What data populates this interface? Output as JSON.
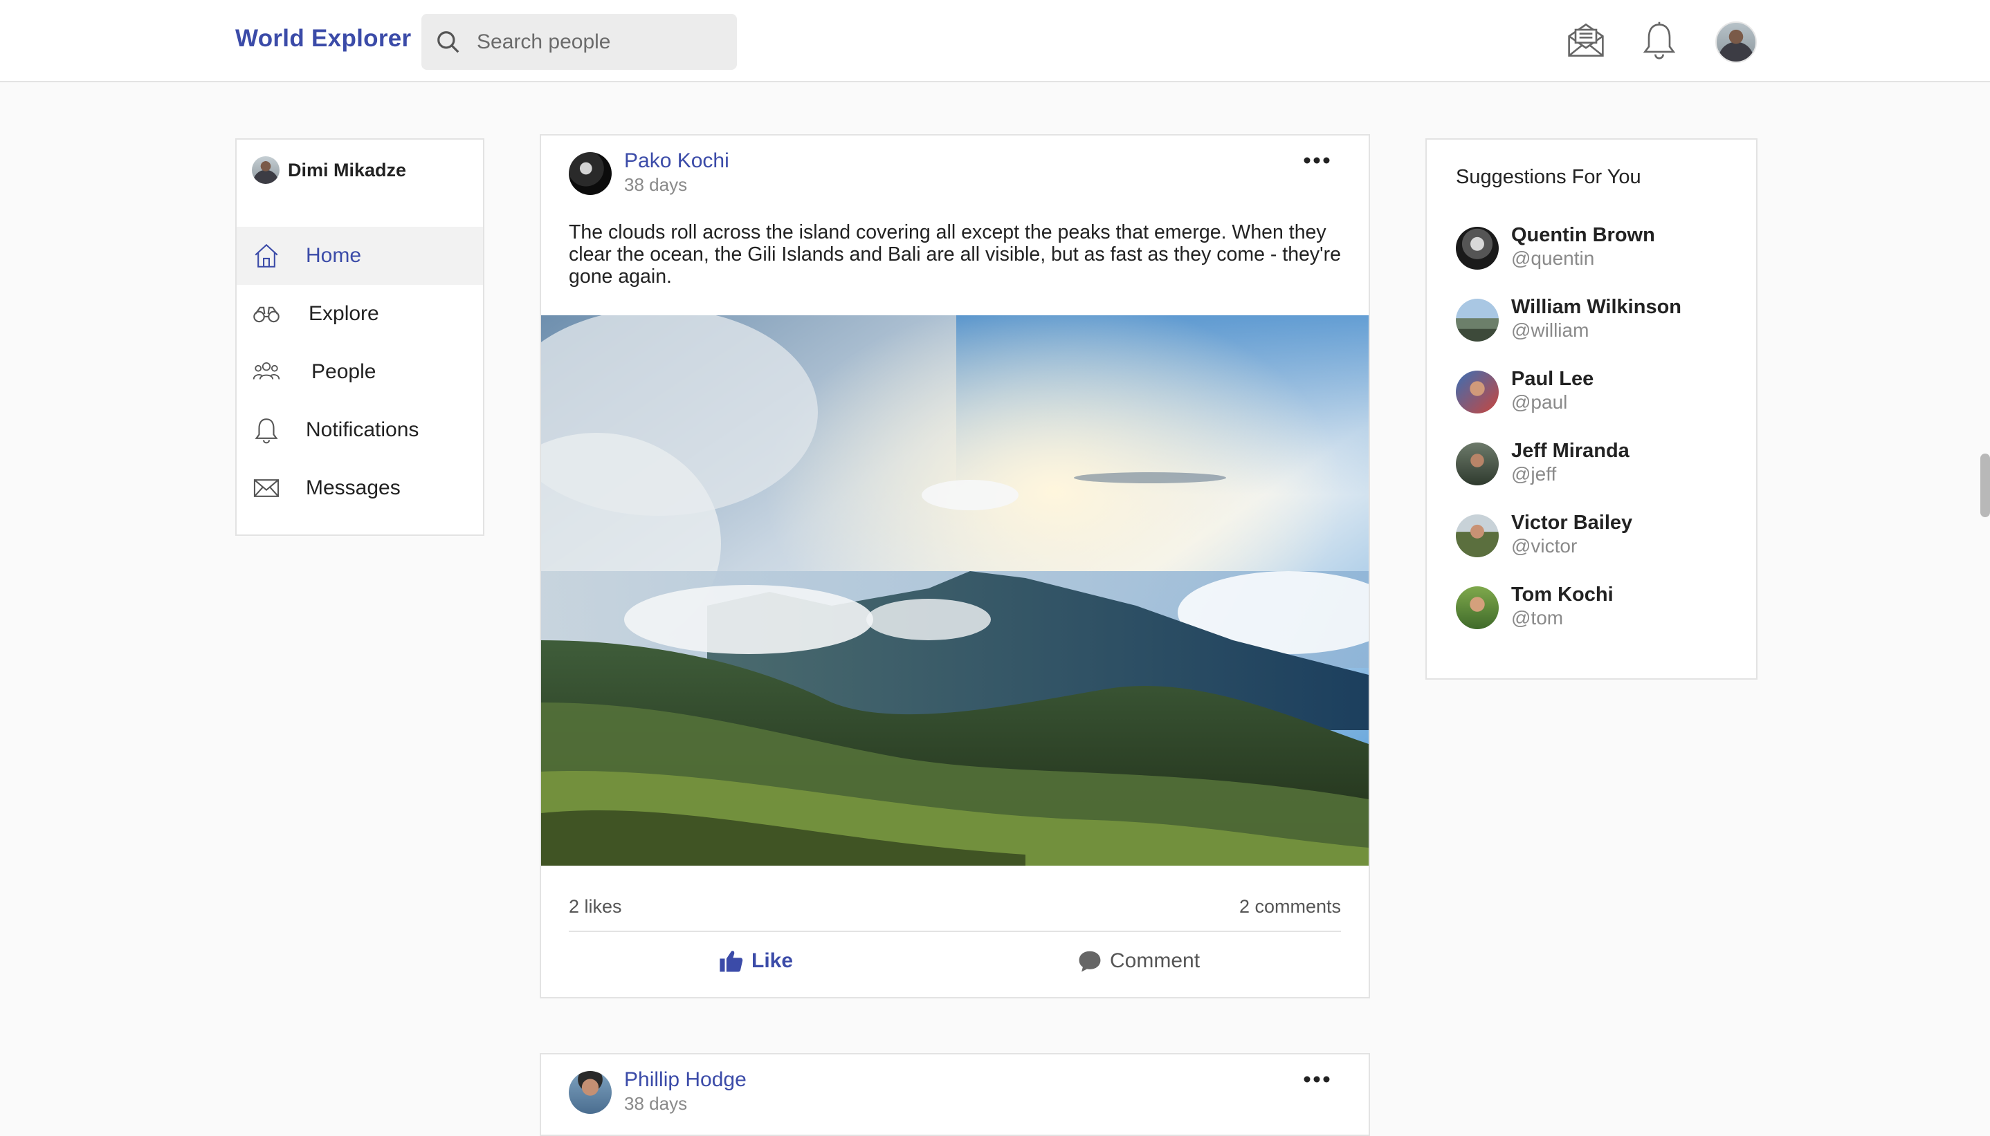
{
  "header": {
    "brand": "World Explorer",
    "search_placeholder": "Search people",
    "icons": [
      "envelope-open-icon",
      "bell-icon",
      "avatar"
    ]
  },
  "sidebar": {
    "user_name": "Dimi Mikadze",
    "items": [
      {
        "label": "Home",
        "icon": "home-icon",
        "active": true
      },
      {
        "label": "Explore",
        "icon": "binoculars-icon",
        "active": false
      },
      {
        "label": "People",
        "icon": "people-icon",
        "active": false
      },
      {
        "label": "Notifications",
        "icon": "bell-icon",
        "active": false
      },
      {
        "label": "Messages",
        "icon": "envelope-icon",
        "active": false
      }
    ]
  },
  "feed": {
    "posts": [
      {
        "author": "Pako Kochi",
        "time": "38 days",
        "text": "The clouds roll across the island covering all except the peaks that emerge. When they clear the ocean, the Gili Islands and Bali are all visible, but as fast as they come - they're gone again.",
        "likes": "2 likes",
        "comments": "2 comments",
        "like_label": "Like",
        "comment_label": "Comment"
      },
      {
        "author": "Phillip Hodge",
        "time": "38 days"
      }
    ]
  },
  "suggestions": {
    "title": "Suggestions For You",
    "people": [
      {
        "name": "Quentin Brown",
        "handle": "@quentin"
      },
      {
        "name": "William Wilkinson",
        "handle": "@william"
      },
      {
        "name": "Paul Lee",
        "handle": "@paul"
      },
      {
        "name": "Jeff Miranda",
        "handle": "@jeff"
      },
      {
        "name": "Victor Bailey",
        "handle": "@victor"
      },
      {
        "name": "Tom Kochi",
        "handle": "@tom"
      }
    ]
  },
  "colors": {
    "accent": "#3b4ba8",
    "background": "#fafafa",
    "border": "#e3e3e3"
  }
}
